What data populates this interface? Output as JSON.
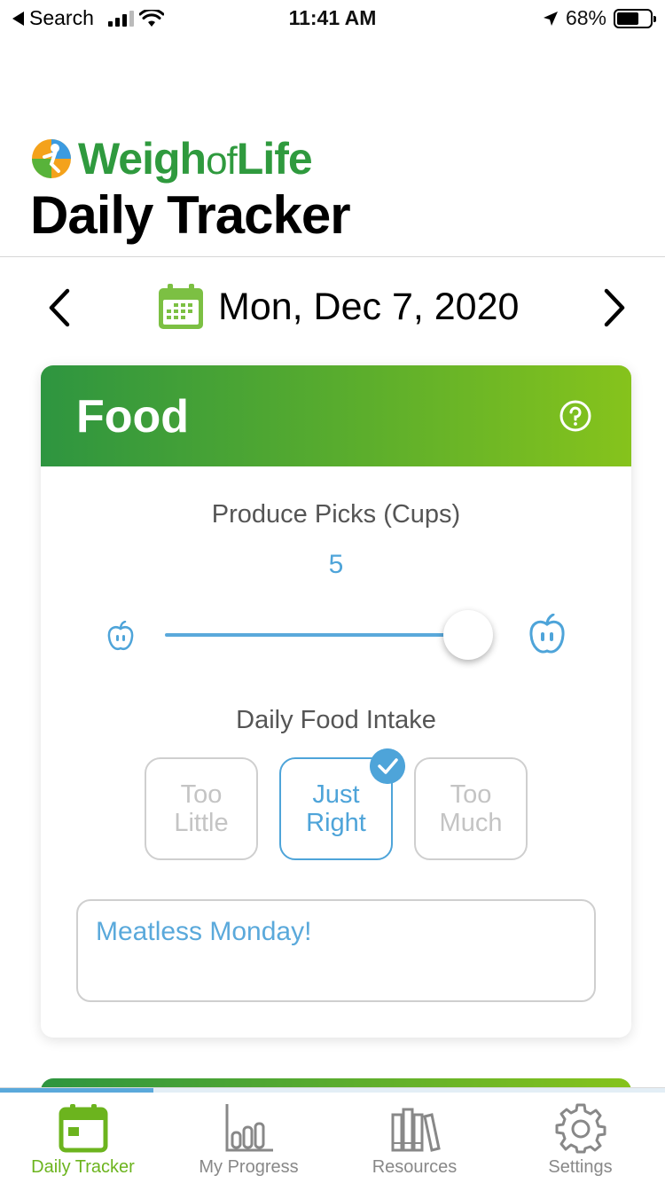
{
  "status_bar": {
    "back_label": "Search",
    "time": "11:41 AM",
    "battery": "68%",
    "battery_level": 0.68
  },
  "header": {
    "logo_part1": "Weigh",
    "logo_part2": "of",
    "logo_part3": "Life",
    "title": "Daily Tracker"
  },
  "date_nav": {
    "date": "Mon, Dec 7, 2020",
    "prev_icon": "chevron-left-icon",
    "next_icon": "chevron-right-icon",
    "calendar_icon": "calendar-icon"
  },
  "food_card": {
    "title": "Food",
    "help_icon": "question-circle-icon",
    "produce_label": "Produce Picks (Cups)",
    "produce_value": "5",
    "produce_fraction": 0.95,
    "intake_label": "Daily Food Intake",
    "options": [
      {
        "line1": "Too",
        "line2": "Little",
        "selected": false
      },
      {
        "line1": "Just",
        "line2": "Right",
        "selected": true
      },
      {
        "line1": "Too",
        "line2": "Much",
        "selected": false
      }
    ],
    "note": "Meatless Monday!"
  },
  "tab_bar": {
    "scroll_progress": 0.23,
    "tabs": [
      {
        "label": "Daily Tracker",
        "icon": "calendar-tab-icon",
        "active": true
      },
      {
        "label": "My Progress",
        "icon": "bar-chart-icon",
        "active": false
      },
      {
        "label": "Resources",
        "icon": "books-icon",
        "active": false
      },
      {
        "label": "Settings",
        "icon": "gear-icon",
        "active": false
      }
    ]
  },
  "colors": {
    "brand_green": "#2f9a3e",
    "accent_blue": "#4ea4d9",
    "active_tab": "#6cb41e"
  }
}
